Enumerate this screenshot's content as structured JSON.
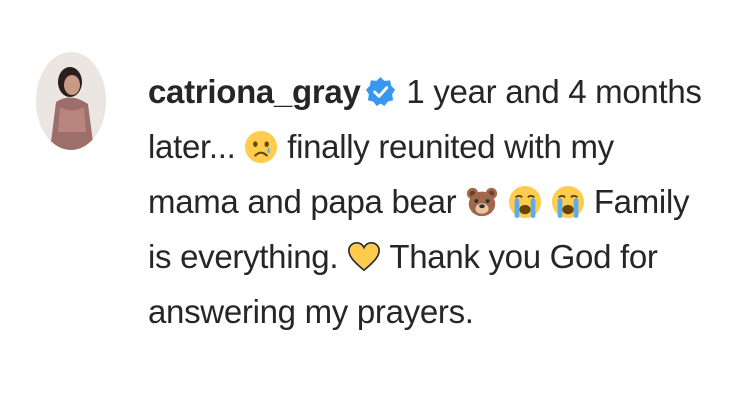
{
  "post": {
    "username": "catriona_gray",
    "verified_icon": "verified-badge-icon",
    "caption_parts": {
      "t1": "1 year and 4 months",
      "t2": "later...",
      "t3": "finally reunited with my",
      "t4": "mama and papa bear",
      "t5": "Family",
      "t6": "is everything.",
      "t7": "Thank you God for",
      "t8": "answering my prayers."
    },
    "emojis": [
      "sad-face-emoji",
      "bear-face-emoji",
      "loudly-crying-face-emoji",
      "loudly-crying-face-emoji",
      "yellow-heart-emoji"
    ]
  },
  "colors": {
    "text": "#262626",
    "verified": "#3897f0",
    "emoji_yellow": "#ffcc4d"
  }
}
